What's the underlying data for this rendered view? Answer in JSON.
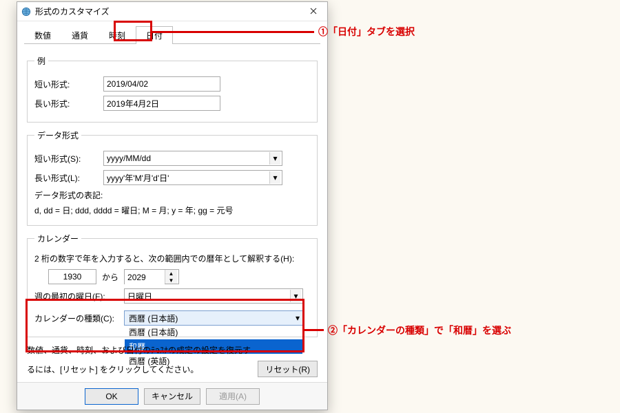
{
  "window": {
    "title": "形式のカスタマイズ"
  },
  "tabs": {
    "t0": "数値",
    "t1": "通貨",
    "t2": "時刻",
    "t3": "日付",
    "t4_vis": "・・-!-#・"
  },
  "example": {
    "legend": "例",
    "short_label": "短い形式:",
    "short_value": "2019/04/02",
    "long_label": "長い形式:",
    "long_value": "2019年4月2日"
  },
  "dataformat": {
    "legend": "データ形式",
    "short_label": "短い形式(S):",
    "short_value": "yyyy/MM/dd",
    "long_label": "長い形式(L):",
    "long_value": "yyyy'年'M'月'd'日'",
    "note_title": "データ形式の表記:",
    "note_body": "d, dd = 日;  ddd, dddd = 曜日; M = 月; y = 年; gg = 元号"
  },
  "calendar": {
    "legend": "カレンダー",
    "range_text": "2 桁の数字で年を入力すると、次の範囲内での暦年として解釈する(H):",
    "from_year": "1930",
    "kara": "から",
    "to_year": "2029",
    "firstday_label": "週の最初の曜日(F):",
    "firstday_value": "日曜日",
    "type_label": "カレンダーの種類(C):",
    "type_selected": "西暦 (日本語)",
    "opts": {
      "o0": "西暦 (日本語)",
      "o1": "和暦",
      "o2": "西暦 (英語)"
    }
  },
  "bottom": {
    "line1_vis": "数値、通貨、時刻、および日付のﾃจｽﾅの成定の設定を復元す",
    "line2": "るには、[リセット] をクリックしてください。",
    "reset": "リセット(R)"
  },
  "buttons": {
    "ok": "OK",
    "cancel": "キャンセル",
    "apply": "適用(A)"
  },
  "annotations": {
    "a1": "①「日付」タブを選択",
    "a2": "②「カレンダーの種類」で「和暦」を選ぶ"
  }
}
